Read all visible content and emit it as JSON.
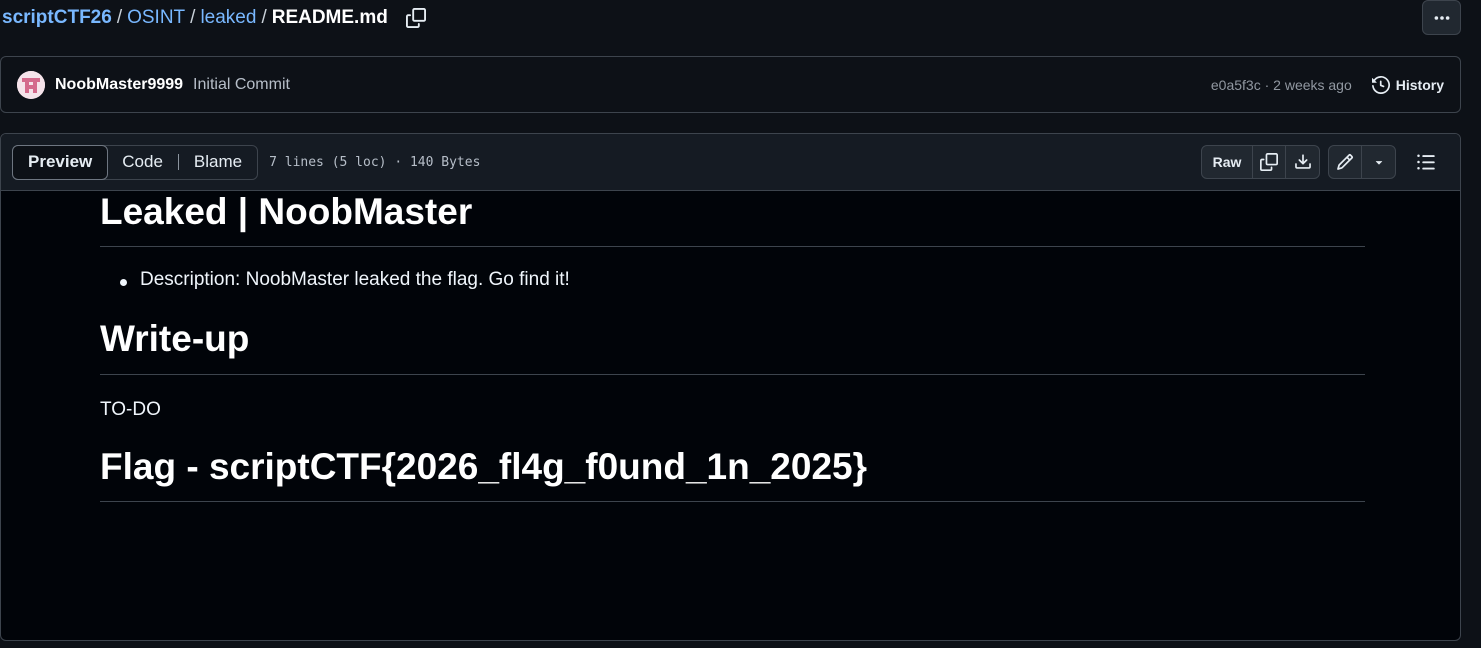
{
  "breadcrumb": {
    "repo": "scriptCTF26",
    "folder1": "OSINT",
    "folder2": "leaked",
    "separator": "/",
    "file": "README.md"
  },
  "commit": {
    "author": "NoobMaster9999",
    "message": "Initial Commit",
    "meta": "e0a5f3c · 2 weeks ago",
    "history_label": "History"
  },
  "file_header": {
    "tabs": [
      {
        "label": "Preview",
        "active": true
      },
      {
        "label": "Code",
        "active": false
      },
      {
        "label": "Blame",
        "active": false
      }
    ],
    "info": "7 lines (5 loc) · 140 Bytes",
    "raw_label": "Raw"
  },
  "markdown": {
    "title": "Leaked | NoobMaster",
    "bullet": "Description: NoobMaster leaked the flag. Go find it!",
    "writeup_heading": "Write-up",
    "writeup_text": "TO-DO",
    "flag_heading": "Flag - scriptCTF{2026_fl4g_f0und_1n_2025}"
  },
  "icons": {
    "copy": "copy-icon",
    "more": "kebab-horizontal-icon",
    "history": "history-icon",
    "download": "download-icon",
    "edit": "pencil-icon",
    "dropdown": "triangle-down-icon",
    "outline": "list-unordered-icon"
  },
  "colors": {
    "link": "#79b8ff",
    "background": "#0d1117",
    "canvas": "#010409",
    "border": "#3d444d"
  }
}
